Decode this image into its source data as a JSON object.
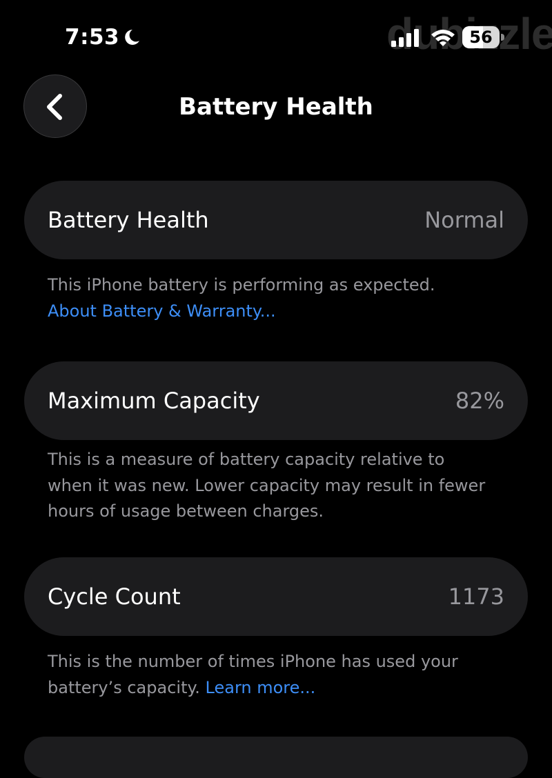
{
  "status_bar": {
    "time": "7:53",
    "battery_percent": "56",
    "battery_level": 0.56,
    "watermark": "dubizzle"
  },
  "nav": {
    "title": "Battery Health"
  },
  "battery_health": {
    "label": "Battery Health",
    "value": "Normal",
    "footnote": "This iPhone battery is performing as expected.",
    "link": "About Battery & Warranty..."
  },
  "maximum_capacity": {
    "label": "Maximum Capacity",
    "value": "82%",
    "footnote_line1": "This is a measure of battery capacity relative to",
    "footnote_line2": "when it was new. Lower capacity may result in fewer",
    "footnote_line3": "hours of usage between charges."
  },
  "cycle_count": {
    "label": "Cycle Count",
    "value": "1173",
    "footnote_line1": "This is the number of times iPhone has used your",
    "footnote_line2": "battery’s capacity.",
    "link": "Learn more..."
  },
  "colors": {
    "background": "#000000",
    "row_background": "#1c1c1e",
    "secondary_text": "#98989d",
    "link": "#3d8ef7"
  }
}
